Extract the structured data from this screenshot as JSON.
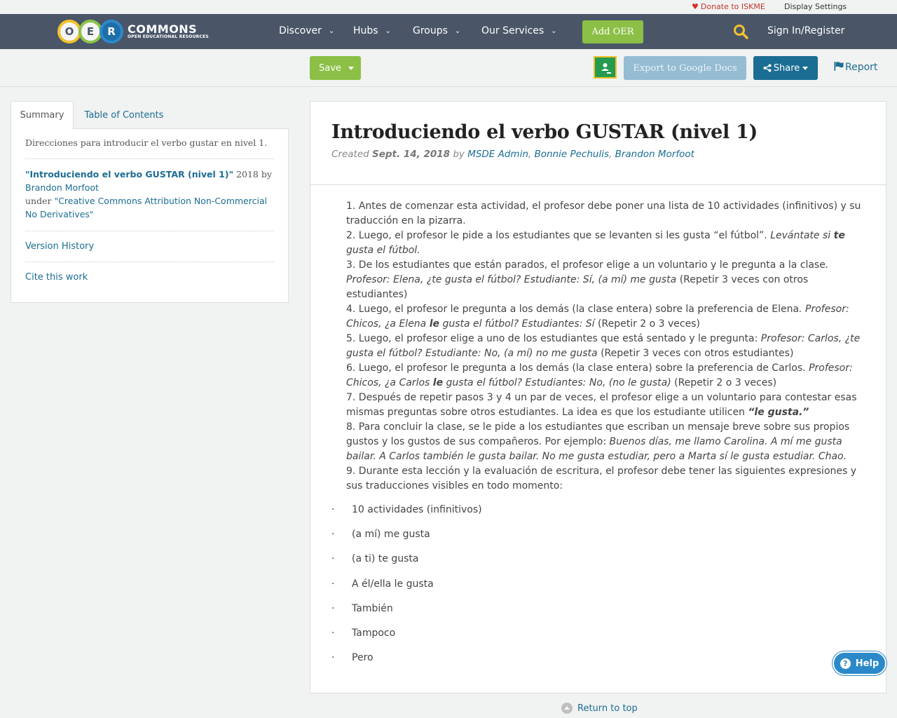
{
  "topbar": {
    "donate": "Donate to ISKME",
    "display_settings": "Display Settings"
  },
  "nav": {
    "logo_letters": [
      "O",
      "E",
      "R"
    ],
    "logo_title": "COMMONS",
    "logo_subtitle": "OPEN EDUCATIONAL RESOURCES",
    "items": [
      "Discover",
      "Hubs",
      "Groups",
      "Our Services"
    ],
    "add_oer": "Add OER",
    "signin": "Sign In/Register"
  },
  "toolbar": {
    "save": "Save",
    "export": "Export to Google Docs",
    "share": "Share",
    "report": "Report"
  },
  "sidebar": {
    "tabs": [
      "Summary",
      "Table of Contents"
    ],
    "description": "Direcciones para introducir el verbo gustar en nivel 1.",
    "attrib_title": "\"Introduciendo el verbo GUSTAR (nivel 1)\"",
    "attrib_year": " 2018 by ",
    "attrib_author": "Brandon Morfoot",
    "attrib_under": "under ",
    "attrib_license": "\"Creative Commons Attribution Non-Commercial No Derivatives\"",
    "version_history": "Version History",
    "cite": "Cite this work"
  },
  "main": {
    "title": "Introduciendo el verbo GUSTAR (nivel 1)",
    "created_prefix": "Created ",
    "created_date": "Sept. 14, 2018",
    "by": " by ",
    "authors": [
      "MSDE Admin",
      "Bonnie Pechulis",
      "Brandon Morfoot"
    ],
    "steps": [
      {
        "plain": "1. Antes de comenzar esta actividad, el profesor debe poner una lista de 10 actividades (infinitivos) y su traducción en la pizarra."
      },
      {
        "plain": "2. Luego, el profesor le pide a los estudiantes que se levanten si les gusta “el fútbol”. ",
        "ital1": "Levántate si ",
        "bold": "te",
        "ital2": " gusta el fútbol."
      },
      {
        "plain": "3. De los estudiantes que están parados, el profesor elige a un voluntario y le pregunta a la clase",
        "ital1": ". Profesor: Elena, ¿te gusta el fútbol? Estudiante: Sí, (a mí) me gusta",
        "tail": " (Repetir 3 veces con otros estudiantes)"
      },
      {
        "plain": "4. Luego, el profesor le pregunta a los demás (la clase entera) sobre la preferencia de Elena",
        "ital1": ". Profesor: Chicos, ¿a Elena ",
        "bold": "le",
        "ital2": " gusta el fútbol? Estudiantes: Sí",
        "tail": " (Repetir 2 o 3 veces)"
      },
      {
        "plain": "5.  Luego, el profesor elige a uno de los estudiantes que está sentado y le pregunta: ",
        "ital1": "Profesor: Carlos, ¿te gusta el fútbol? Estudiante: No, (a mí) no me gusta",
        "tail": " (Repetir 3 veces con otros estudiantes)"
      },
      {
        "plain": "6. Luego, el profesor le pregunta a los demás (la clase entera) sobre la preferencia de Carlos. ",
        "ital1": "Profesor: Chicos, ¿a Carlos ",
        "bold": "le",
        "ital2": " gusta el fútbol? Estudiantes: No, (no le gusta)",
        "tail": " (Repetir 2 o 3 veces)"
      },
      {
        "plain": "7. Después de repetir pasos 3 y 4 un par de veces, el profesor elige a un voluntario para contestar esas mismas preguntas sobre otros estudiantes. La idea es que los estudiante utilicen ",
        "bolditalic": "“le gusta.”"
      },
      {
        "plain": "8. Para concluir la clase, se le pide a los estudiantes que escriban un mensaje breve sobre sus propios gustos y los gustos de sus compañeros. Por ejemplo: ",
        "ital1": "Buenos días, me llamo Carolina. A mí me gusta bailar. A Carlos también le gusta bailar. No me gusta estudiar, pero a Marta sí le gusta estudiar. Chao."
      },
      {
        "plain": "9. Durante esta lección y la evaluación de escritura, el profesor debe tener las siguientes expresiones y sus traducciones visibles en todo momento:"
      }
    ],
    "bullet_char": "·",
    "bullets": [
      "10 actividades (infinitivos)",
      "(a mí) me gusta",
      "(a ti) te gusta",
      "A él/ella le gusta",
      "También",
      "Tampoco",
      "Pero"
    ]
  },
  "help": "Help",
  "return_top": "Return to top",
  "colors": {
    "navbar": "#4a5668",
    "green": "#8bbf45",
    "link": "#1b6d93",
    "export": "#94bcd3",
    "help": "#2c89c9"
  }
}
